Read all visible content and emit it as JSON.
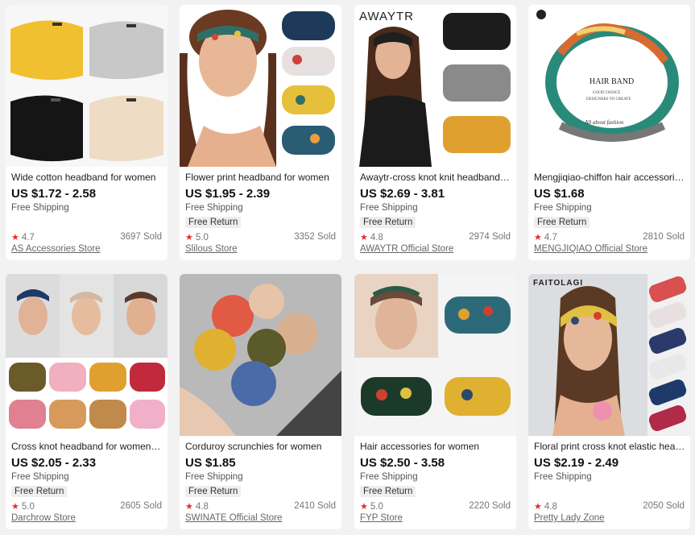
{
  "products": [
    {
      "title": "Wide cotton headband for women",
      "price": "US $1.72 - 2.58",
      "shipping": "Free Shipping",
      "free_return": "",
      "rating": "4.7",
      "sold": "3697 Sold",
      "store": "AS Accessories Store",
      "brand_tag": ""
    },
    {
      "title": "Flower print headband for women",
      "price": "US $1.95 - 2.39",
      "shipping": "Free Shipping",
      "free_return": "Free Return",
      "rating": "5.0",
      "sold": "3352 Sold",
      "store": "Slilous Store",
      "brand_tag": ""
    },
    {
      "title": "Awaytr-cross knot knit headband f...",
      "price": "US $2.69 - 3.81",
      "shipping": "Free Shipping",
      "free_return": "Free Return",
      "rating": "4.8",
      "sold": "2974 Sold",
      "store": "AWAYTR Official Store",
      "brand_tag": "AWAYTR"
    },
    {
      "title": "Mengjiqiao-chiffon hair accessorie...",
      "price": "US $1.68",
      "shipping": "Free Shipping",
      "free_return": "Free Return",
      "rating": "4.7",
      "sold": "2810 Sold",
      "store": "MENGJIQIAO Official Store",
      "brand_tag": ""
    },
    {
      "title": "Cross knot headband for women a...",
      "price": "US $2.05 - 2.33",
      "shipping": "Free Shipping",
      "free_return": "Free Return",
      "rating": "5.0",
      "sold": "2605 Sold",
      "store": "Darchrow  Store",
      "brand_tag": ""
    },
    {
      "title": "Corduroy scrunchies for women",
      "price": "US $1.85",
      "shipping": "Free Shipping",
      "free_return": "Free Return",
      "rating": "4.8",
      "sold": "2410 Sold",
      "store": "SWINATE Official Store",
      "brand_tag": ""
    },
    {
      "title": "Hair accessories for women",
      "price": "US $2.50 - 3.58",
      "shipping": "Free Shipping",
      "free_return": "Free Return",
      "rating": "5.0",
      "sold": "2220 Sold",
      "store": "FYP Store",
      "brand_tag": ""
    },
    {
      "title": "Floral print cross knot elastic head...",
      "price": "US $2.19 - 2.49",
      "shipping": "Free Shipping",
      "free_return": "",
      "rating": "4.8",
      "sold": "2050 Sold",
      "store": "Pretty Lady Zone",
      "brand_tag": "FAITOLAGI"
    }
  ],
  "product_images": {
    "hair_band_label": "HAIR BAND",
    "hair_band_sub": "GOOD CHOICE",
    "hair_band_sub2": "DESIGNERS TO CREATE",
    "hair_band_script": "All about fashion"
  },
  "colors": {
    "star": "#e0302c",
    "card_bg": "#ffffff",
    "page_bg": "#f2f2f2"
  }
}
